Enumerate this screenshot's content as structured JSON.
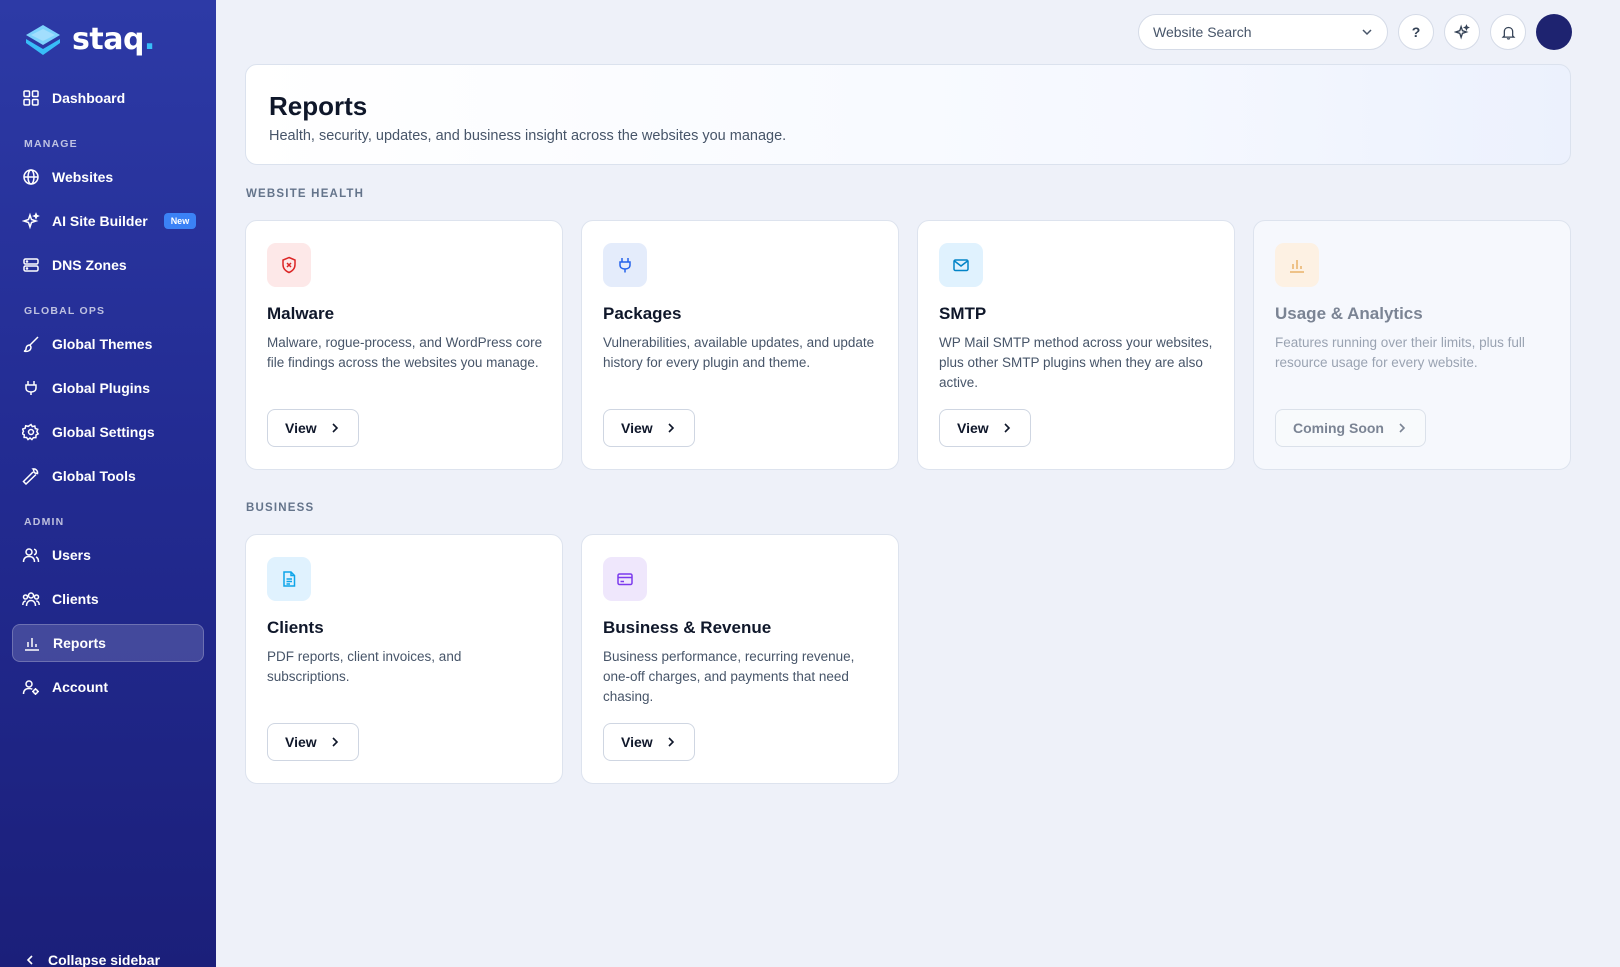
{
  "brand": {
    "name": "staq",
    "dot": "."
  },
  "sidebar": {
    "dashboard": "Dashboard",
    "sections": {
      "manage": "MANAGE",
      "global_ops": "GLOBAL OPS",
      "admin": "ADMIN"
    },
    "items": {
      "websites": "Websites",
      "ai_site_builder": "AI Site Builder",
      "ai_badge": "New",
      "dns_zones": "DNS Zones",
      "global_themes": "Global Themes",
      "global_plugins": "Global Plugins",
      "global_settings": "Global Settings",
      "global_tools": "Global Tools",
      "users": "Users",
      "clients": "Clients",
      "reports": "Reports",
      "account": "Account"
    },
    "active": "reports",
    "collapse": "Collapse sidebar"
  },
  "topbar": {
    "search_label": "Website Search",
    "help": "?"
  },
  "header": {
    "title": "Reports",
    "subtitle": "Health, security, updates, and business insight across the websites you manage."
  },
  "sections": {
    "website_health": "WEBSITE HEALTH",
    "business": "BUSINESS"
  },
  "cards": {
    "malware": {
      "title": "Malware",
      "desc": "Malware, rogue-process, and WordPress core file findings across the websites you manage.",
      "button": "View",
      "icon": "shield-x-icon",
      "icon_bg": "#fde8e8",
      "icon_color": "#dc2626"
    },
    "packages": {
      "title": "Packages",
      "desc": "Vulnerabilities, available updates, and update history for every plugin and theme.",
      "button": "View",
      "icon": "plug-icon",
      "icon_bg": "#e4ecfb",
      "icon_color": "#2563eb"
    },
    "smtp": {
      "title": "SMTP",
      "desc": "WP Mail SMTP method across your websites, plus other SMTP plugins when they are also active.",
      "button": "View",
      "icon": "mail-icon",
      "icon_bg": "#e0f2fe",
      "icon_color": "#0284c7"
    },
    "usage": {
      "title": "Usage & Analytics",
      "desc": "Features running over their limits, plus full resource usage for every website.",
      "button": "Coming Soon",
      "icon": "bar-chart-icon",
      "icon_bg": "#fdf1e3",
      "icon_color": "#e8b26a"
    },
    "clients": {
      "title": "Clients",
      "desc": "PDF reports, client invoices, and subscriptions.",
      "button": "View",
      "icon": "document-icon",
      "icon_bg": "#e0f2fe",
      "icon_color": "#0ea5e9"
    },
    "business": {
      "title": "Business & Revenue",
      "desc": "Business performance, recurring revenue, one-off charges, and payments that need chasing.",
      "button": "View",
      "icon": "credit-card-icon",
      "icon_bg": "#efe7fc",
      "icon_color": "#7c3aed"
    }
  }
}
